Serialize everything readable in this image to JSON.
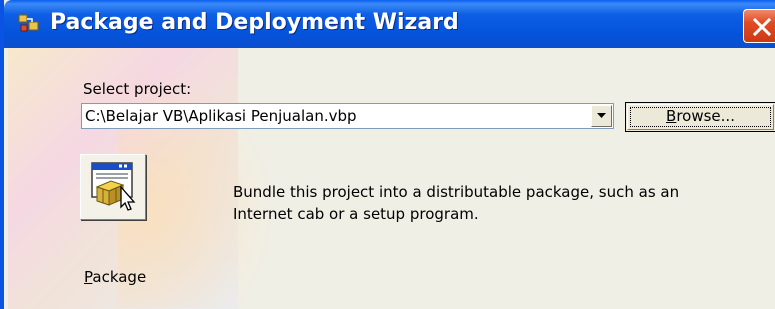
{
  "window": {
    "title": "Package and Deployment Wizard",
    "icons": {
      "app": "package-wizard-app-icon",
      "close": "close-icon"
    }
  },
  "project": {
    "label_prefix": "Select pro",
    "label_accel": "j",
    "label_suffix": "ect:",
    "path_value": "C:\\Belajar VB\\Aplikasi Penjualan.vbp",
    "dropdown_icon": "chevron-down-icon"
  },
  "browse": {
    "label_accel": "B",
    "label_rest": "rowse..."
  },
  "package": {
    "icon": "package-box-icon",
    "label_accel": "P",
    "label_rest": "ackage",
    "description_line1": "Bundle this project into a distributable package, such as an",
    "description_line2": "Internet cab or a setup program."
  },
  "colors": {
    "titlebar": "#0553db",
    "close": "#e04b23",
    "face": "#f0efe6",
    "field_border": "#7f9db9"
  }
}
